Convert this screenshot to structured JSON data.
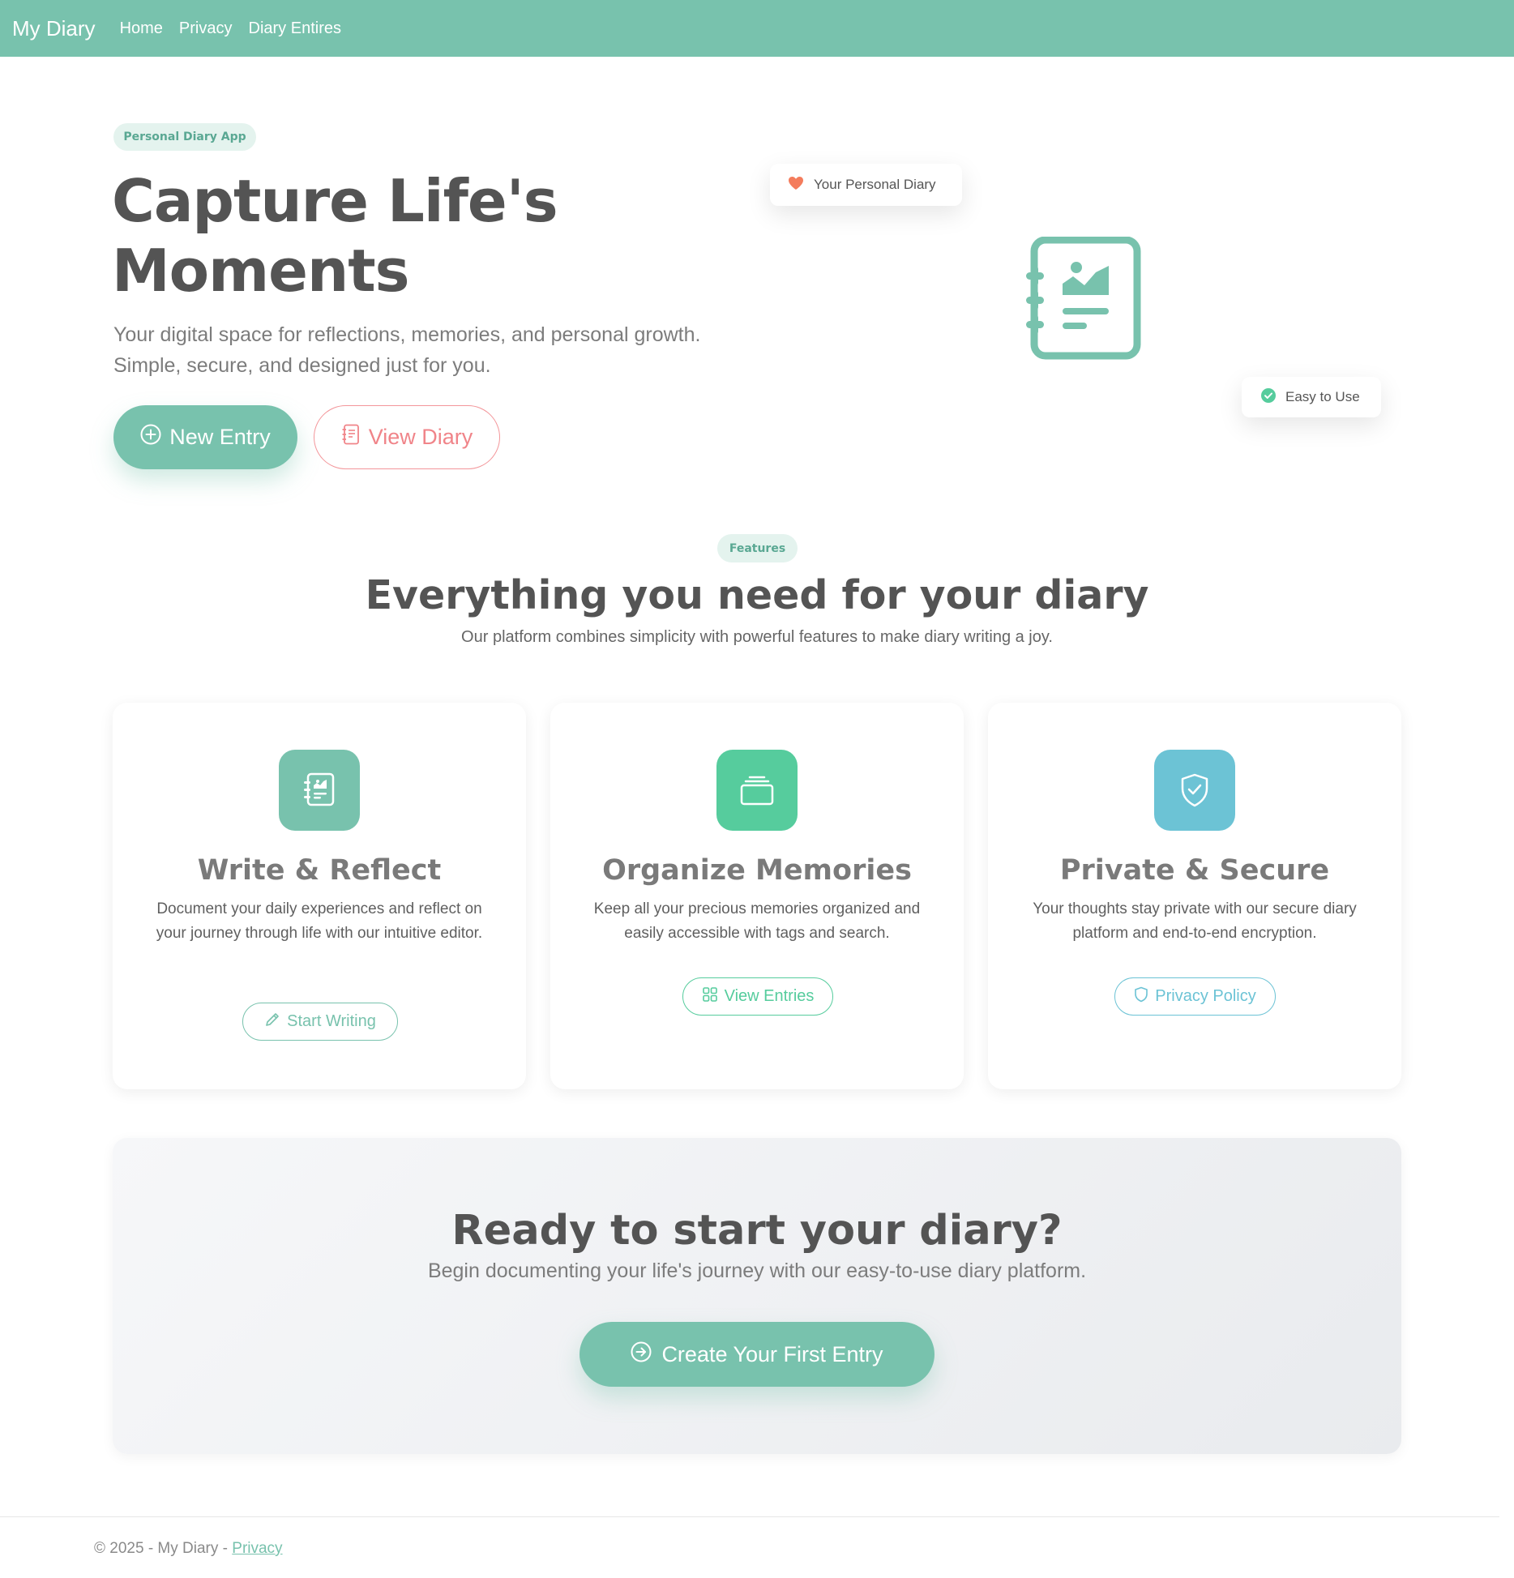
{
  "navbar": {
    "brand": "My Diary",
    "links": [
      "Home",
      "Privacy",
      "Diary Entires"
    ]
  },
  "hero": {
    "badge": "Personal Diary App",
    "title_line1": "Capture Life's",
    "title_line2": "Moments",
    "subtitle": "Your digital space for reflections, memories, and personal growth. Simple, secure, and designed just for you.",
    "primary_button": "New Entry",
    "secondary_button": "View Diary",
    "float_card_top": "Your Personal Diary",
    "float_card_bottom": "Easy to Use"
  },
  "features": {
    "badge": "Features",
    "title": "Everything you need for your diary",
    "subtitle": "Our platform combines simplicity with powerful features to make diary writing a joy.",
    "cards": [
      {
        "title": "Write & Reflect",
        "text": "Document your daily experiences and reflect on your journey through life with our intuitive editor.",
        "button": "Start Writing",
        "icon": "journal-icon",
        "color": "#78c2ad"
      },
      {
        "title": "Organize Memories",
        "text": "Keep all your precious memories organized and easily accessible with tags and search.",
        "button": "View Entries",
        "icon": "collection-icon",
        "color": "#56cc9d"
      },
      {
        "title": "Private & Secure",
        "text": "Your thoughts stay private with our secure diary platform and end-to-end encryption.",
        "button": "Privacy Policy",
        "icon": "shield-check-icon",
        "color": "#6cc3d5"
      }
    ]
  },
  "cta": {
    "title": "Ready to start your diary?",
    "subtitle": "Begin documenting your life's journey with our easy-to-use diary platform.",
    "button": "Create Your First Entry"
  },
  "footer": {
    "text": "© 2025 - My Diary - ",
    "link": "Privacy"
  },
  "colors": {
    "primary": "#78c2ad",
    "secondary": "#f3969a",
    "success": "#56cc9d",
    "info": "#6cc3d5",
    "heart": "#f47c5c"
  }
}
